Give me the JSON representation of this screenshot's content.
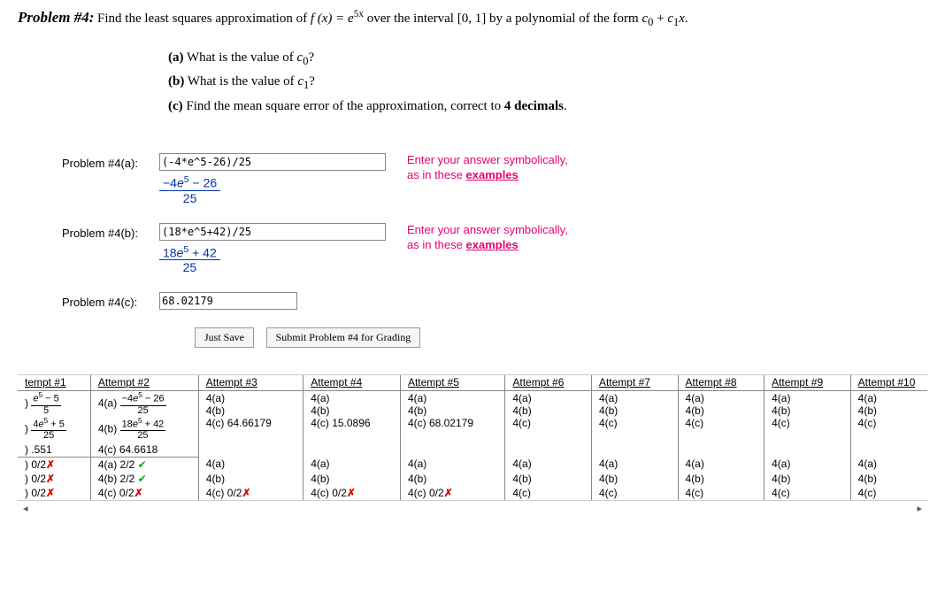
{
  "header": {
    "title": "Problem #4:",
    "prompt_pre": "Find the least squares approximation of ",
    "fx": "f (x)  =  e",
    "exp": "5x",
    "prompt_mid": " over the interval [0, 1] by a polynomial of the form ",
    "poly_c0": "c",
    "poly_sub0": "0",
    "poly_plus": " + ",
    "poly_c1": "c",
    "poly_sub1": "1",
    "poly_x": "x",
    "poly_end": "."
  },
  "parts": {
    "a": {
      "lbl": "(a)",
      "txt_pre": " What is the value of ",
      "var": "c",
      "sub": "0",
      "q": "?"
    },
    "b": {
      "lbl": "(b)",
      "txt_pre": " What is the value of ",
      "var": "c",
      "sub": "1",
      "q": "?"
    },
    "c": {
      "lbl": "(c)",
      "txt": " Find the mean square error of the approximation, correct to ",
      "bold": "4 decimals",
      "end": "."
    }
  },
  "answers": {
    "a": {
      "label": "Problem #4(a):",
      "value": "(-4*e^5-26)/25",
      "disp_num": "−4e⁵ − 26",
      "disp_den": "25"
    },
    "b": {
      "label": "Problem #4(b):",
      "value": "(18*e^5+42)/25",
      "disp_num": "18e⁵ + 42",
      "disp_den": "25"
    },
    "c": {
      "label": "Problem #4(c):",
      "value": "68.02179"
    }
  },
  "hint": {
    "line1": "Enter your answer symbolically,",
    "line2_pre": "as in these ",
    "link": "examples"
  },
  "buttons": {
    "save": "Just Save",
    "submit": "Submit Problem #4 for Grading"
  },
  "attempts": {
    "headers": [
      "tempt #1",
      "Attempt #2",
      "Attempt #3",
      "Attempt #4",
      "Attempt #5",
      "Attempt #6",
      "Attempt #7",
      "Attempt #8",
      "Attempt #9",
      "Attempt #10"
    ],
    "row1a": {
      "pre": ")",
      "num": "e⁵ − 5",
      "den": "5"
    },
    "row1b": {
      "pre": ")",
      "num": "4e⁵ + 5",
      "den": "25"
    },
    "row1c": {
      "pre": ")",
      "val": ".551"
    },
    "col2r1": {
      "pre": "4(a)",
      "num": "−4e⁵ − 26",
      "den": "25"
    },
    "col2r2": {
      "pre": "4(b)",
      "num": "18e⁵ + 42",
      "den": "25"
    },
    "col2r3": "4(c) 64.6618",
    "col3": {
      "a": "4(a)",
      "b": "4(b)",
      "c": "4(c) 64.66179"
    },
    "col4": {
      "a": "4(a)",
      "b": "4(b)",
      "c": "4(c) 15.0896"
    },
    "col5": {
      "a": "4(a)",
      "b": "4(b)",
      "c": "4(c) 68.02179"
    },
    "blank": {
      "a": "4(a)",
      "b": "4(b)",
      "c": "4(c)"
    },
    "score1": {
      "c0": ") 0/2",
      "c1": "4(a) 2/2 ",
      "rest_a": "4(a)"
    },
    "score2": {
      "c0": ") 0/2",
      "c1": "4(b) 2/2 ",
      "rest_b": "4(b)"
    },
    "score3": {
      "c0": ") 0/2",
      "c1": "4(c) 0/2",
      "rest_c_x": "4(c) 0/2",
      "rest_c": "4(c)"
    }
  }
}
